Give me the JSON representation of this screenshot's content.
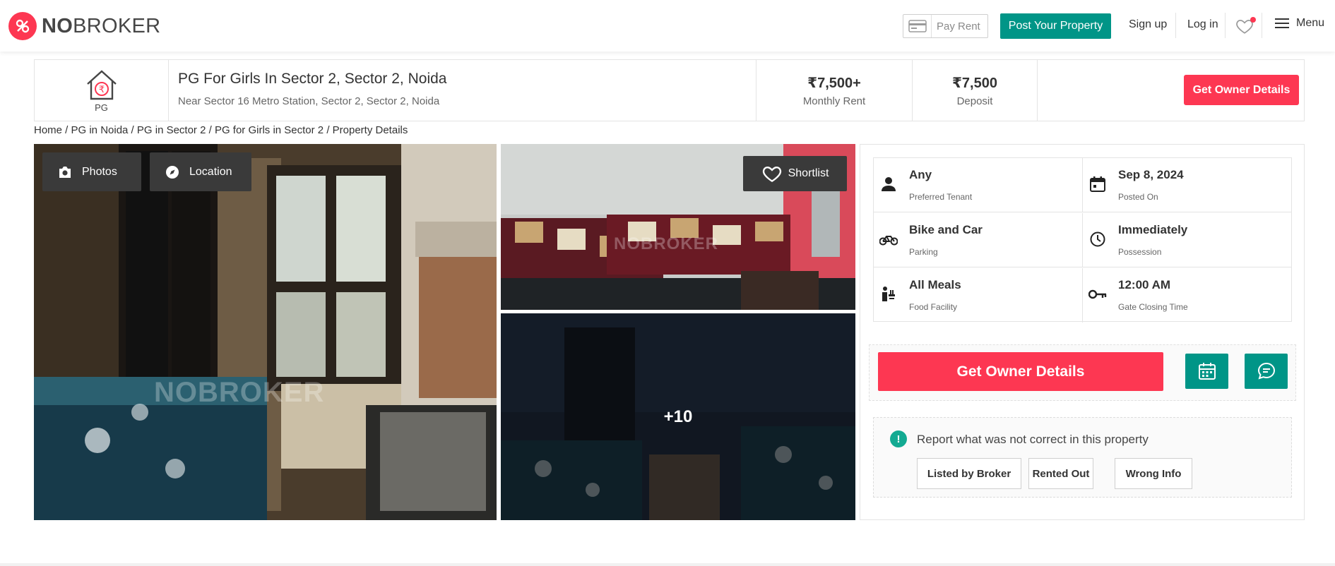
{
  "brand": {
    "name_bold": "NO",
    "name_rest": "BROKER"
  },
  "nav": {
    "pay_rent": "Pay Rent",
    "post_property": "Post Your Property",
    "sign_up": "Sign up",
    "log_in": "Log in",
    "menu": "Menu"
  },
  "header": {
    "type_label": "PG",
    "title": "PG For Girls In Sector 2, Sector 2, Noida",
    "subtitle": "Near Sector 16 Metro Station, Sector 2, Sector 2, Noida",
    "rent_value": "₹7,500+",
    "rent_label": "Monthly Rent",
    "deposit_value": "₹7,500",
    "deposit_label": "Deposit",
    "owner_button": "Get Owner Details"
  },
  "breadcrumb": "Home / PG in Noida / PG in Sector 2 / PG for Girls in Sector 2 / Property Details",
  "gallery": {
    "photos_label": "Photos",
    "location_label": "Location",
    "shortlist_label": "Shortlist",
    "more_count": "+10",
    "watermark": "NOBROKER"
  },
  "details": {
    "items": [
      {
        "value": "Any",
        "label": "Preferred Tenant",
        "icon": "person-icon"
      },
      {
        "value": "Sep 8, 2024",
        "label": "Posted On",
        "icon": "calendar-icon"
      },
      {
        "value": "Bike and Car",
        "label": "Parking",
        "icon": "bike-icon"
      },
      {
        "value": "Immediately",
        "label": "Possession",
        "icon": "clock-icon"
      },
      {
        "value": "All Meals",
        "label": "Food Facility",
        "icon": "food-icon"
      },
      {
        "value": "12:00 AM",
        "label": "Gate Closing Time",
        "icon": "key-icon"
      }
    ],
    "owner_button": "Get Owner Details",
    "report_text": "Report what was not correct in this property",
    "report_options": [
      "Listed by Broker",
      "Rented Out",
      "Wrong Info"
    ]
  },
  "colors": {
    "brand_red": "#fd3752",
    "teal": "#009587",
    "report_green": "#13aa92"
  }
}
